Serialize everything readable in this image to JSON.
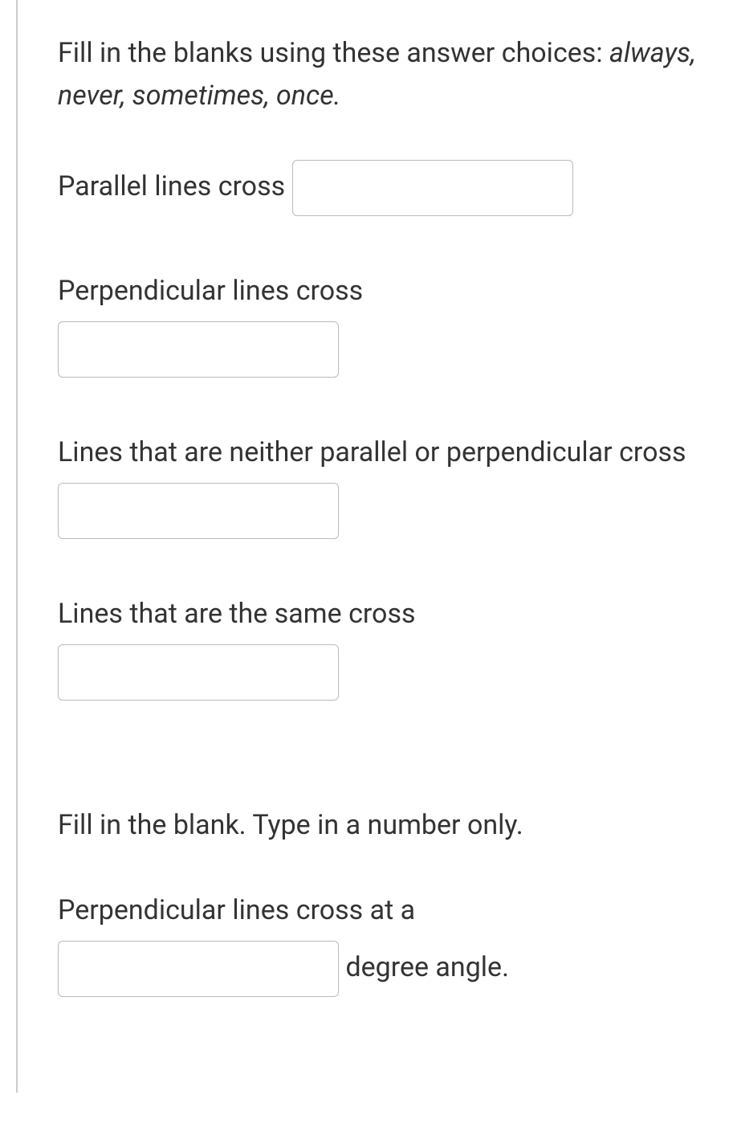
{
  "instruction1_prefix": "Fill in the blanks using these answer choices: ",
  "instruction1_choices": "always, never, sometimes, once.",
  "q1_text": "Parallel lines cross ",
  "q2_text": "Perpendicular lines cross",
  "q3_text_a": "Lines that are neither parallel or perpendicular cross ",
  "q4_text": "Lines that are the same cross",
  "instruction2": "Fill in the blank.  Type in a number only.",
  "q5_text_a": "Perpendicular lines cross at a",
  "q5_text_b": " degree angle.",
  "inputs": {
    "q1": "",
    "q2": "",
    "q3": "",
    "q4": "",
    "q5": ""
  }
}
